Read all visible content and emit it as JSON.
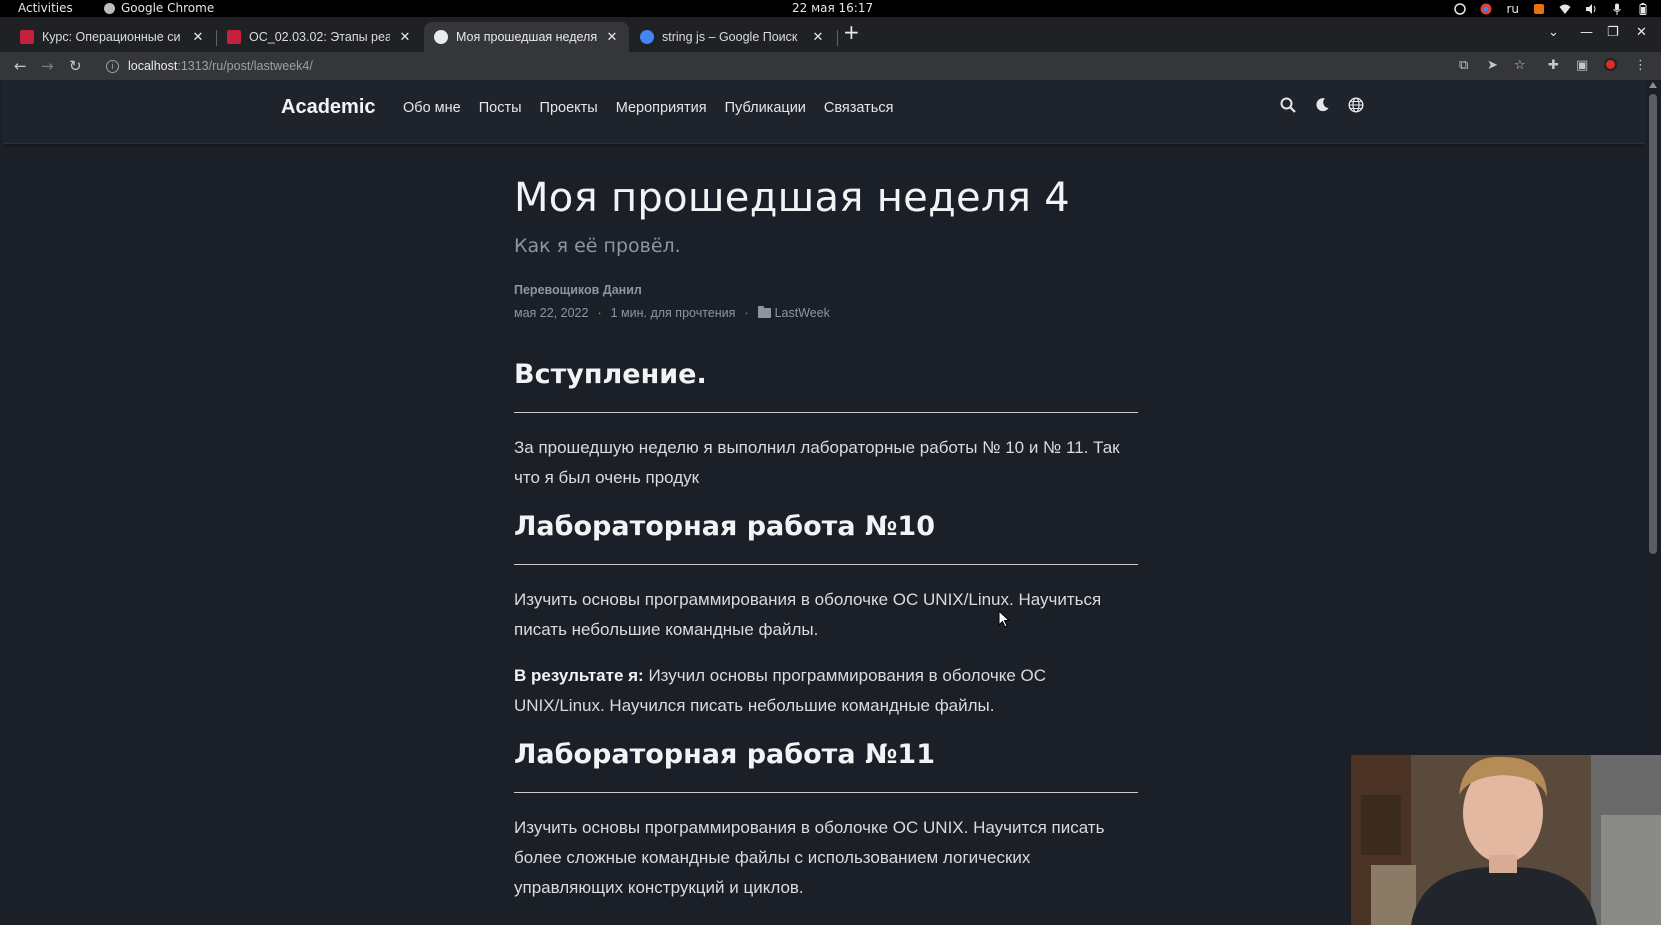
{
  "system_bar": {
    "activities": "Activities",
    "app_name": "Google Chrome",
    "clock": "22 мая  16:17",
    "keyboard_layout": "ru"
  },
  "browser": {
    "tabs": [
      {
        "title": "Курс: Операционные си",
        "active": false,
        "favicon_color": "#c5203e"
      },
      {
        "title": "OC_02.03.02: Этапы реал",
        "active": false,
        "favicon_color": "#c5203e"
      },
      {
        "title": "Моя прошедшая неделя",
        "active": true,
        "favicon_color": "#e8eaed"
      },
      {
        "title": "string js – Google Поиск",
        "active": false,
        "favicon_color": "#4285f4"
      }
    ],
    "url_host": "localhost",
    "url_rest": ":1313/ru/post/lastweek4/"
  },
  "site": {
    "brand": "Academic",
    "menu": [
      "Обо мне",
      "Посты",
      "Проекты",
      "Мероприятия",
      "Публикации",
      "Связаться"
    ]
  },
  "article": {
    "title": "Моя прошедшая неделя 4",
    "subtitle": "Как я её провёл.",
    "author": "Перевощиков Данил",
    "date": "мая 22, 2022",
    "reading_time": "1 мин. для прочтения",
    "category": "LastWeek",
    "sections": [
      {
        "heading": "Вступление.",
        "paragraphs": [
          {
            "bold": "",
            "text": "За прошедшую неделю я выполнил лабораторные работы № 10 и № 11. Так что я был очень продук"
          }
        ]
      },
      {
        "heading": "Лабораторная работа №10",
        "paragraphs": [
          {
            "bold": "",
            "text": "Изучить основы программирования в оболочке ОС UNIX/Linux. Научиться писать небольшие командные файлы."
          },
          {
            "bold": "В результате я:",
            "text": " Изучил основы программирования в оболочке ОС UNIX/Linux. Научился писать небольшие командные файлы."
          }
        ]
      },
      {
        "heading": "Лабораторная работа №11",
        "paragraphs": [
          {
            "bold": "",
            "text": "Изучить основы программирования в оболочке ОС UNIX. Научится писать более сложные командные файлы с использованием логических управляющих конструкций и циклов."
          }
        ]
      }
    ]
  },
  "colors": {
    "page_bg": "#1b1f27",
    "nav_bg": "#1f242c",
    "heading": "#f2f3f5",
    "muted": "#8f959e"
  }
}
